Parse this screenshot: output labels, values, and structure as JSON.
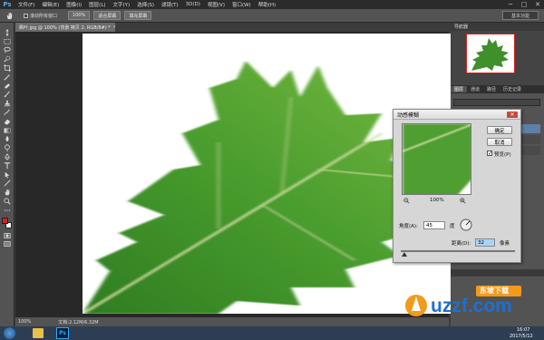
{
  "app": {
    "logo": "Ps"
  },
  "menu": [
    "文件(F)",
    "编辑(E)",
    "图像(I)",
    "图层(L)",
    "文字(Y)",
    "选择(S)",
    "滤镜(T)",
    "3D(D)",
    "视图(V)",
    "窗口(W)",
    "帮助(H)"
  ],
  "window_controls": {
    "minimize": "─",
    "maximize": "□",
    "close": "✕"
  },
  "options_bar": {
    "scroll_all": "滚动所有窗口",
    "zoom_100": "100%",
    "fit_screen": "适合屏幕",
    "fill_screen": "填充屏幕",
    "workspace": "基本功能"
  },
  "document": {
    "tab_title": "枫叶.jpg @ 100% (背景 拷贝 2, RGB/8#) *",
    "tab_close": "×",
    "zoom": "100%",
    "doc_info": "文档:2.12M/6.32M"
  },
  "panels": {
    "navigator": "导航器",
    "layers_tabs": [
      "图层",
      "通道",
      "路径",
      "历史记录"
    ]
  },
  "dialog": {
    "title": "动感模糊",
    "ok": "确定",
    "cancel": "取消",
    "preview_label": "预览(P)",
    "preview_checked": true,
    "zoom_percent": "100%",
    "angle_label": "角度(A):",
    "angle_value": "45",
    "angle_unit": "度",
    "distance_label": "距离(D):",
    "distance_value": "32",
    "distance_unit": "像素",
    "distance_slider_fraction": 0.03
  },
  "taskbar": {
    "time": "16:07",
    "date": "2017/5/12"
  },
  "watermark": {
    "text": "uzzf.com",
    "badge": "东坡下载"
  },
  "colors": {
    "accent_blue": "#1f6fd1",
    "leaf_green": "#3f8f2a",
    "close_red": "#c54a3f",
    "fg_color": "#d42020",
    "bg_color": "#ffffff"
  }
}
